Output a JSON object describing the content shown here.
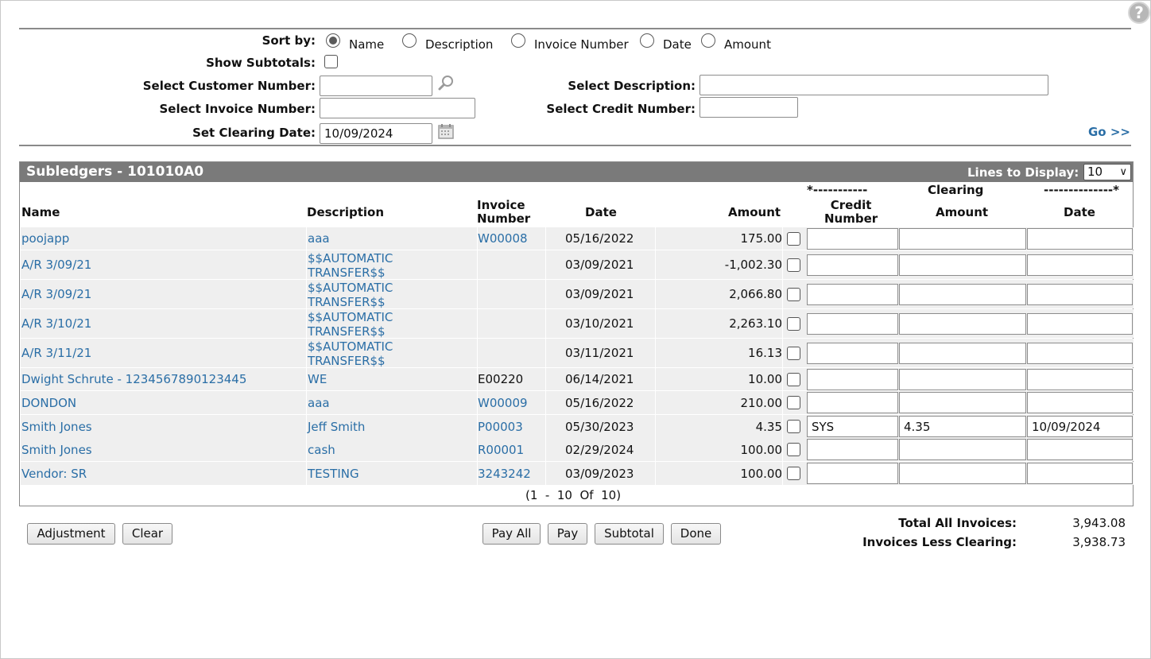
{
  "help_icon": "?",
  "filters": {
    "sort_by_label": "Sort by:",
    "sort_options": [
      "Name",
      "Description",
      "Invoice Number",
      "Date",
      "Amount"
    ],
    "sort_selected": "Name",
    "show_subtotals_label": "Show Subtotals:",
    "customer_number_label": "Select Customer Number:",
    "customer_number_value": "",
    "invoice_number_label": "Select Invoice Number:",
    "invoice_number_value": "",
    "clearing_date_label": "Set Clearing Date:",
    "clearing_date_value": "10/09/2024",
    "description_label": "Select Description:",
    "description_value": "",
    "credit_number_label": "Select Credit Number:",
    "credit_number_value": "",
    "go_link": "Go >>"
  },
  "panel": {
    "title": "Subledgers - 101010A0",
    "lines_label": "Lines to Display:",
    "lines_value": "10"
  },
  "columns": {
    "name": "Name",
    "description": "Description",
    "invoice_number_1": "Invoice",
    "invoice_number_2": "Number",
    "date": "Date",
    "amount": "Amount",
    "clearing_left": "*-----------",
    "clearing_center": "Clearing",
    "clearing_right": "--------------*",
    "credit_number_1": "Credit",
    "credit_number_2": "Number",
    "clearing_amount": "Amount",
    "clearing_date": "Date"
  },
  "rows": [
    {
      "name": "poojapp",
      "desc1": "aaa",
      "desc2": "",
      "invoice": "W00008",
      "invoice_link": true,
      "date": "05/16/2022",
      "amount": "175.00",
      "credit": "",
      "clr_amount": "",
      "clr_date": ""
    },
    {
      "name": "A/R 3/09/21",
      "desc1": "$$AUTOMATIC",
      "desc2": "TRANSFER$$",
      "invoice": "",
      "invoice_link": false,
      "date": "03/09/2021",
      "amount": "-1,002.30",
      "credit": "",
      "clr_amount": "",
      "clr_date": ""
    },
    {
      "name": "A/R 3/09/21",
      "desc1": "$$AUTOMATIC",
      "desc2": "TRANSFER$$",
      "invoice": "",
      "invoice_link": false,
      "date": "03/09/2021",
      "amount": "2,066.80",
      "credit": "",
      "clr_amount": "",
      "clr_date": ""
    },
    {
      "name": "A/R 3/10/21",
      "desc1": "$$AUTOMATIC",
      "desc2": "TRANSFER$$",
      "invoice": "",
      "invoice_link": false,
      "date": "03/10/2021",
      "amount": "2,263.10",
      "credit": "",
      "clr_amount": "",
      "clr_date": ""
    },
    {
      "name": "A/R 3/11/21",
      "desc1": "$$AUTOMATIC",
      "desc2": "TRANSFER$$",
      "invoice": "",
      "invoice_link": false,
      "date": "03/11/2021",
      "amount": "16.13",
      "credit": "",
      "clr_amount": "",
      "clr_date": ""
    },
    {
      "name": "Dwight Schrute - 1234567890123445",
      "desc1": "WE",
      "desc2": "",
      "invoice": "E00220",
      "invoice_link": false,
      "date": "06/14/2021",
      "amount": "10.00",
      "credit": "",
      "clr_amount": "",
      "clr_date": ""
    },
    {
      "name": "DONDON",
      "desc1": "aaa",
      "desc2": "",
      "invoice": "W00009",
      "invoice_link": true,
      "date": "05/16/2022",
      "amount": "210.00",
      "credit": "",
      "clr_amount": "",
      "clr_date": ""
    },
    {
      "name": "Smith Jones",
      "desc1": "Jeff Smith",
      "desc2": "",
      "invoice": "P00003",
      "invoice_link": true,
      "date": "05/30/2023",
      "amount": "4.35",
      "credit": "SYS",
      "clr_amount": "4.35",
      "clr_date": "10/09/2024"
    },
    {
      "name": "Smith Jones",
      "desc1": "cash",
      "desc2": "",
      "invoice": "R00001",
      "invoice_link": true,
      "date": "02/29/2024",
      "amount": "100.00",
      "credit": "",
      "clr_amount": "",
      "clr_date": ""
    },
    {
      "name": "Vendor: SR",
      "desc1": "TESTING",
      "desc2": "",
      "invoice": "3243242",
      "invoice_link": true,
      "date": "03/09/2023",
      "amount": "100.00",
      "credit": "",
      "clr_amount": "",
      "clr_date": ""
    }
  ],
  "pager": "(1  -  10  Of  10)",
  "buttons": {
    "adjustment": "Adjustment",
    "clear": "Clear",
    "pay_all": "Pay All",
    "pay": "Pay",
    "subtotal": "Subtotal",
    "done": "Done"
  },
  "totals": {
    "total_all_label": "Total All Invoices:",
    "total_all_value": "3,943.08",
    "less_clearing_label": "Invoices Less Clearing:",
    "less_clearing_value": "3,938.73"
  },
  "colors": {
    "link": "#2a6ea6",
    "header_bar": "#7a7a7a",
    "row_bg": "#efefef"
  }
}
